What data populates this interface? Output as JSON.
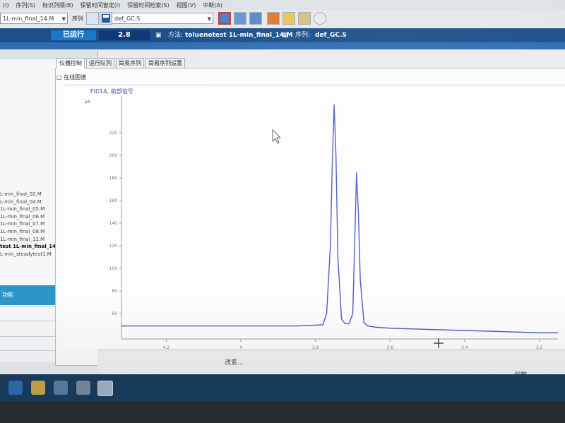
{
  "menu": {
    "items": [
      "(I)",
      "序列(S)",
      "标识列顺(B)",
      "保留时间窗定(I)",
      "保留时间检索(S)",
      "视图(V)",
      "中断(A)"
    ]
  },
  "toolbar": {
    "method_combo_value": "1L-min_final_14.M",
    "sequence_label": "序列",
    "sequence_combo_value": "def_GC.S"
  },
  "status": {
    "run_state": "已运行",
    "run_time": "2.8",
    "method_label": "方法:",
    "method_value": "toluenetest 1L-min_final_14.M",
    "sequence_label": "序列:",
    "sequence_value": "def_GC.S"
  },
  "tabs": [
    {
      "label": "仪器控制"
    },
    {
      "label": "运行队列"
    },
    {
      "label": "简易序列"
    },
    {
      "label": "简易序列设置"
    }
  ],
  "panel": {
    "title": "在线图谱"
  },
  "sidebar": {
    "methods": [
      "L-min_final_02.M",
      "L-min_final_04.M",
      "1L-min_final_05.M",
      "1L-min_final_06.M",
      "1L-min_final_07.M",
      "1L-min_final_08.M",
      "1L-min_final_12.M",
      "test 1L-min_final_14.M",
      "L-min_steadytest1.M"
    ],
    "selected_index": 7,
    "panel_label": "功能"
  },
  "bottom": {
    "left_label": "改变...",
    "right_label": "调整"
  },
  "chart_data": {
    "type": "line",
    "title": "FID1A, 前部信号",
    "xlabel": "",
    "ylabel": "pA",
    "y_ticks": [
      60,
      80,
      100,
      120,
      140,
      160,
      180,
      200,
      220
    ],
    "x_ticks": [
      4.2,
      4,
      3.8,
      3.6,
      3.4,
      3.2
    ],
    "xlim": [
      4.32,
      3.15
    ],
    "ylim": [
      40,
      250
    ],
    "series": [
      {
        "color": "#4a56c8",
        "x": [
          4.32,
          4.2,
          4.0,
          3.85,
          3.78,
          3.77,
          3.76,
          3.755,
          3.75,
          3.745,
          3.74,
          3.73,
          3.72,
          3.71,
          3.7,
          3.695,
          3.69,
          3.685,
          3.68,
          3.67,
          3.66,
          3.64,
          3.6,
          3.5,
          3.4,
          3.3,
          3.2,
          3.15
        ],
        "y": [
          49,
          49,
          49,
          49,
          50,
          60,
          120,
          190,
          245,
          200,
          110,
          55,
          51,
          51,
          60,
          120,
          185,
          150,
          90,
          52,
          49,
          48,
          47,
          46,
          45,
          44,
          43,
          43
        ]
      }
    ]
  }
}
